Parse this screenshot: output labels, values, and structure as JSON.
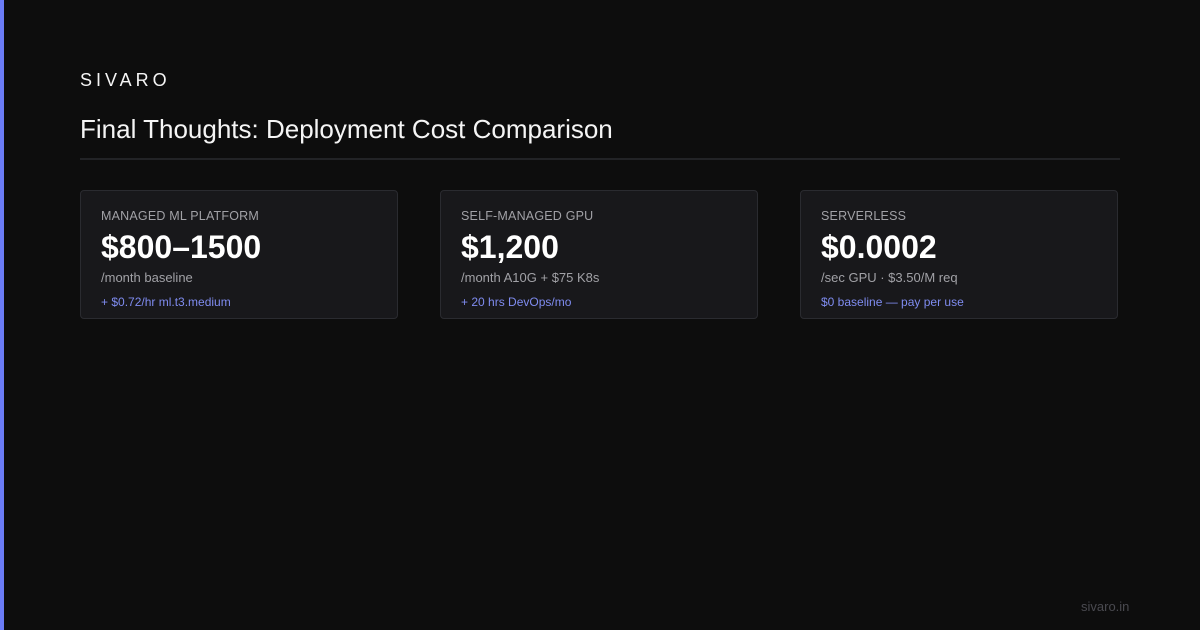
{
  "brand": "SIVARO",
  "title": "Final Thoughts: Deployment Cost Comparison",
  "accent_color": "#6b7cf6",
  "cards": [
    {
      "label": "MANAGED ML PLATFORM",
      "value": "$800–1500",
      "sub": "/month baseline",
      "note": "+ $0.72/hr ml.t3.medium"
    },
    {
      "label": "SELF-MANAGED GPU",
      "value": "$1,200",
      "sub": "/month A10G + $75 K8s",
      "note": "+ 20 hrs DevOps/mo"
    },
    {
      "label": "SERVERLESS",
      "value": "$0.0002",
      "sub": "/sec GPU · $3.50/M req",
      "note": "$0 baseline — pay per use"
    }
  ],
  "footer": "sivaro.in"
}
